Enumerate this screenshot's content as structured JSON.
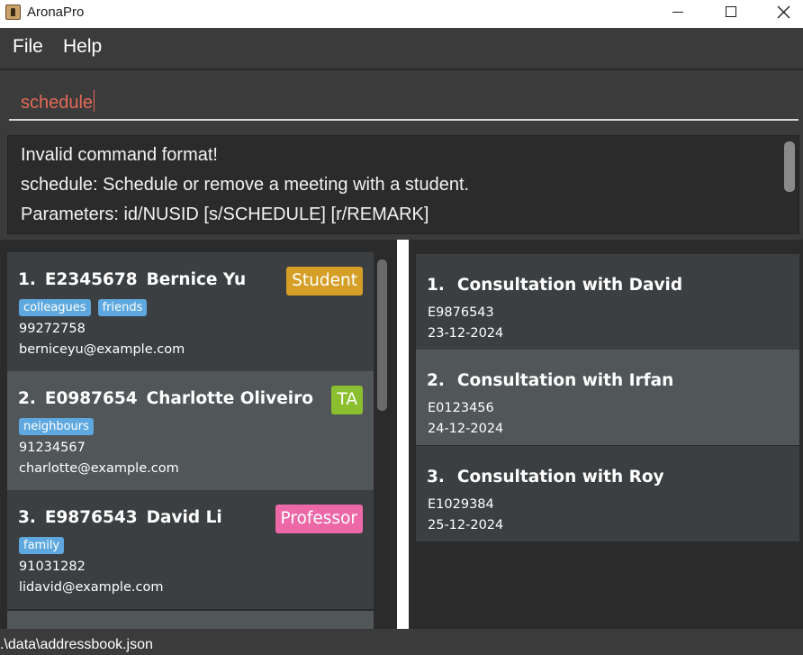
{
  "window": {
    "title": "AronaPro"
  },
  "menu": {
    "file": "File",
    "help": "Help"
  },
  "command": {
    "value": "schedule"
  },
  "result": {
    "lines": [
      "Invalid command format!",
      "schedule: Schedule or remove a meeting with a student.",
      "Parameters: id/NUSID [s/SCHEDULE] [r/REMARK]"
    ]
  },
  "persons": [
    {
      "index": "1.",
      "id": "E2345678",
      "name": "Bernice Yu",
      "role": "Student",
      "role_color": "#d59f27",
      "tags": [
        "colleagues",
        "friends"
      ],
      "phone": "99272758",
      "email": "berniceyu@example.com"
    },
    {
      "index": "2.",
      "id": "E0987654",
      "name": "Charlotte Oliveiro",
      "role": "TA",
      "role_color": "#8bbf2f",
      "tags": [
        "neighbours"
      ],
      "phone": "91234567",
      "email": "charlotte@example.com"
    },
    {
      "index": "3.",
      "id": "E9876543",
      "name": "David Li",
      "role": "Professor",
      "role_color": "#ec68a7",
      "tags": [
        "family"
      ],
      "phone": "91031282",
      "email": "lidavid@example.com"
    }
  ],
  "meetings": [
    {
      "index": "1.",
      "title": "Consultation with David",
      "id": "E9876543",
      "date": "23-12-2024"
    },
    {
      "index": "2.",
      "title": "Consultation with Irfan",
      "id": "E0123456",
      "date": "24-12-2024"
    },
    {
      "index": "3.",
      "title": "Consultation with Roy",
      "id": "E1029384",
      "date": "25-12-2024"
    }
  ],
  "status": {
    "path": ".\\data\\addressbook.json"
  },
  "colors": {
    "tag": "#5ea8df",
    "command_text": "#e46956",
    "card_odd": "#3c3f41",
    "card_even": "#515658"
  }
}
